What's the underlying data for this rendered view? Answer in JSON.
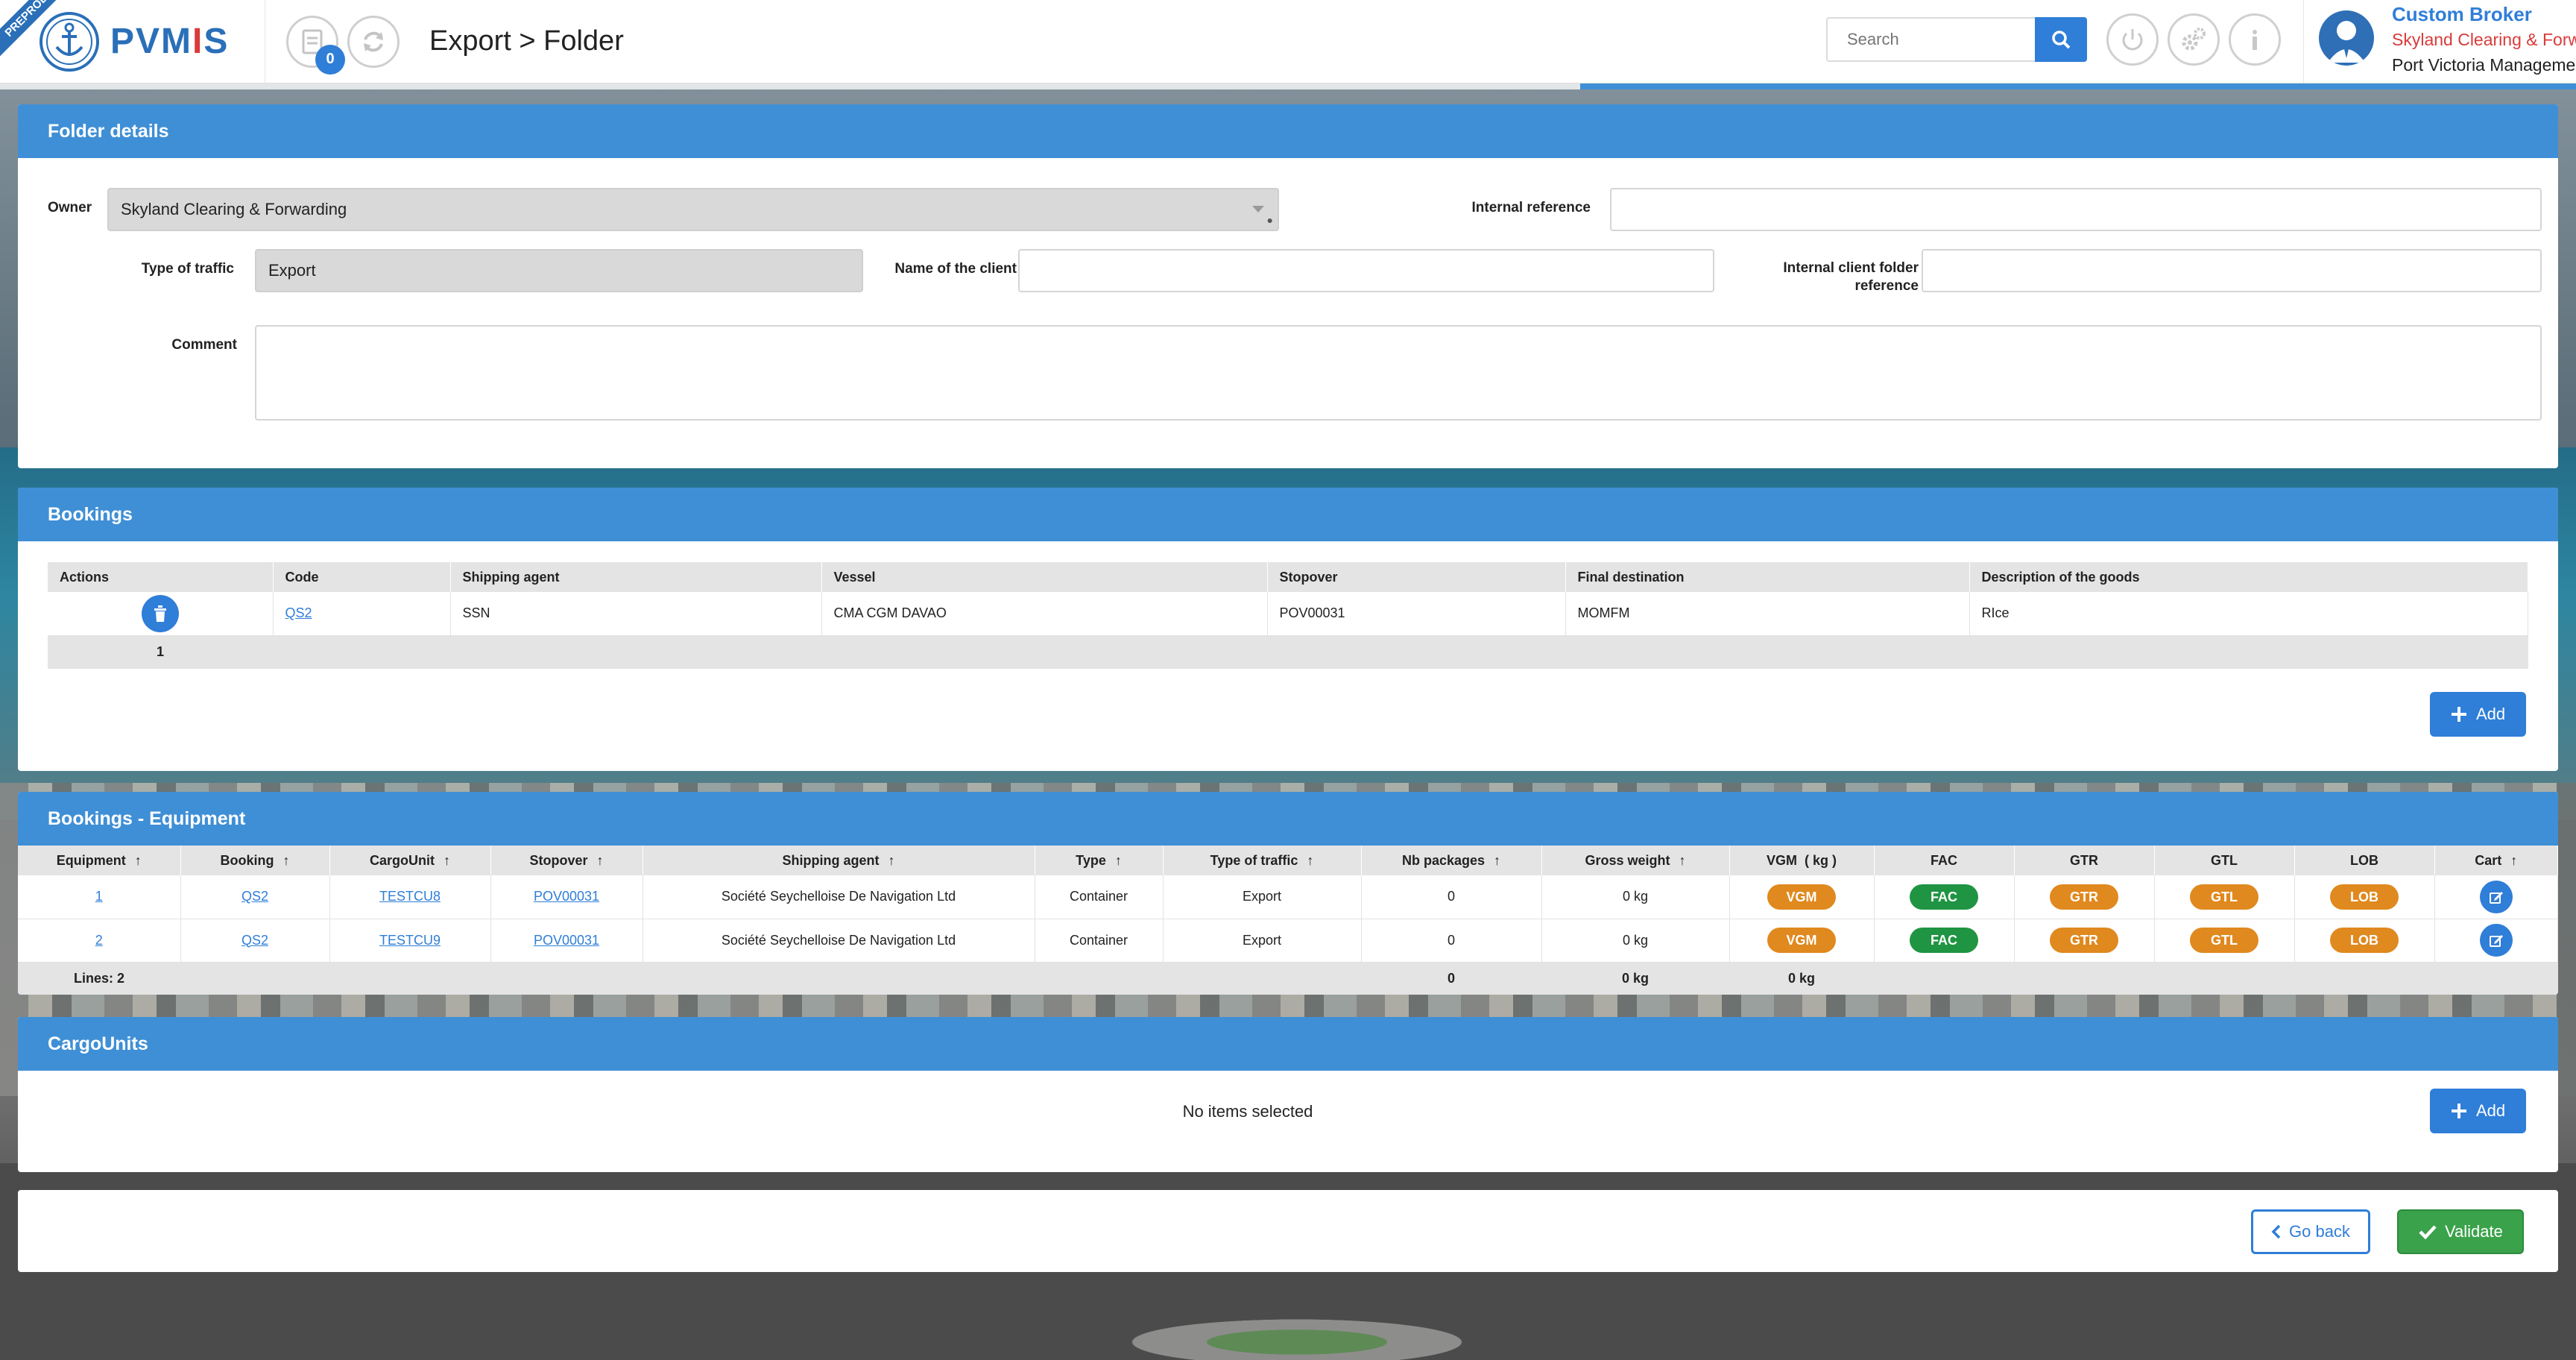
{
  "app": {
    "badge": "PREPROD",
    "logo": "PVMIS"
  },
  "header": {
    "title": "Export > Folder",
    "counter": "0",
    "search_placeholder": "Search"
  },
  "user": {
    "role": "Custom Broker",
    "company": "Skyland Clearing & Forwarding",
    "org": "Port Victoria Management"
  },
  "folder": {
    "title": "Folder details",
    "owner_label": "Owner",
    "owner_value": "Skyland Clearing & Forwarding",
    "internal_ref_label": "Internal reference",
    "internal_ref_value": "",
    "traffic_label": "Type of traffic",
    "traffic_value": "Export",
    "client_label": "Name of the client",
    "client_value": "",
    "client_ref_label": "Internal client folder reference",
    "client_ref_value": "",
    "comment_label": "Comment",
    "comment_value": ""
  },
  "bookings": {
    "title": "Bookings",
    "columns": [
      "Actions",
      "Code",
      "Shipping agent",
      "Vessel",
      "Stopover",
      "Final destination",
      "Description of the goods"
    ],
    "rows": [
      {
        "code": "QS2",
        "agent": "SSN",
        "vessel": "CMA CGM DAVAO",
        "stopover": "POV00031",
        "destination": "MOMFM",
        "goods": "RIce"
      }
    ],
    "footer_count": "1",
    "add_label": "Add"
  },
  "equipment": {
    "title": "Bookings - Equipment",
    "columns": [
      "Equipment",
      "Booking",
      "CargoUnit",
      "Stopover",
      "Shipping agent",
      "Type",
      "Type of traffic",
      "Nb packages",
      "Gross weight",
      "VGM  ( kg )",
      "FAC",
      "GTR",
      "GTL",
      "LOB",
      "Cart"
    ],
    "rows": [
      {
        "equipment": "1",
        "booking": "QS2",
        "cargo": "TESTCU8",
        "stopover": "POV00031",
        "agent": "Société Seychelloise De Navigation Ltd",
        "type": "Container",
        "traffic": "Export",
        "packages": "0",
        "weight": "0 kg",
        "vgm": "VGM",
        "fac": "FAC",
        "gtr": "GTR",
        "gtl": "GTL",
        "lob": "LOB"
      },
      {
        "equipment": "2",
        "booking": "QS2",
        "cargo": "TESTCU9",
        "stopover": "POV00031",
        "agent": "Société Seychelloise De Navigation Ltd",
        "type": "Container",
        "traffic": "Export",
        "packages": "0",
        "weight": "0 kg",
        "vgm": "VGM",
        "fac": "FAC",
        "gtr": "GTR",
        "gtl": "GTL",
        "lob": "LOB"
      }
    ],
    "footer": {
      "lines": "Lines: 2",
      "packages": "0",
      "weight": "0 kg",
      "vgm": "0 kg"
    }
  },
  "cargounits": {
    "title": "CargoUnits",
    "empty": "No items selected",
    "add_label": "Add"
  },
  "actions": {
    "back": "Go back",
    "validate": "Validate"
  },
  "colors": {
    "primary": "#2f7ed8",
    "panel_header": "#3f8fd6",
    "orange": "#e0891f",
    "green": "#1f9442",
    "validate": "#3aa24a"
  }
}
